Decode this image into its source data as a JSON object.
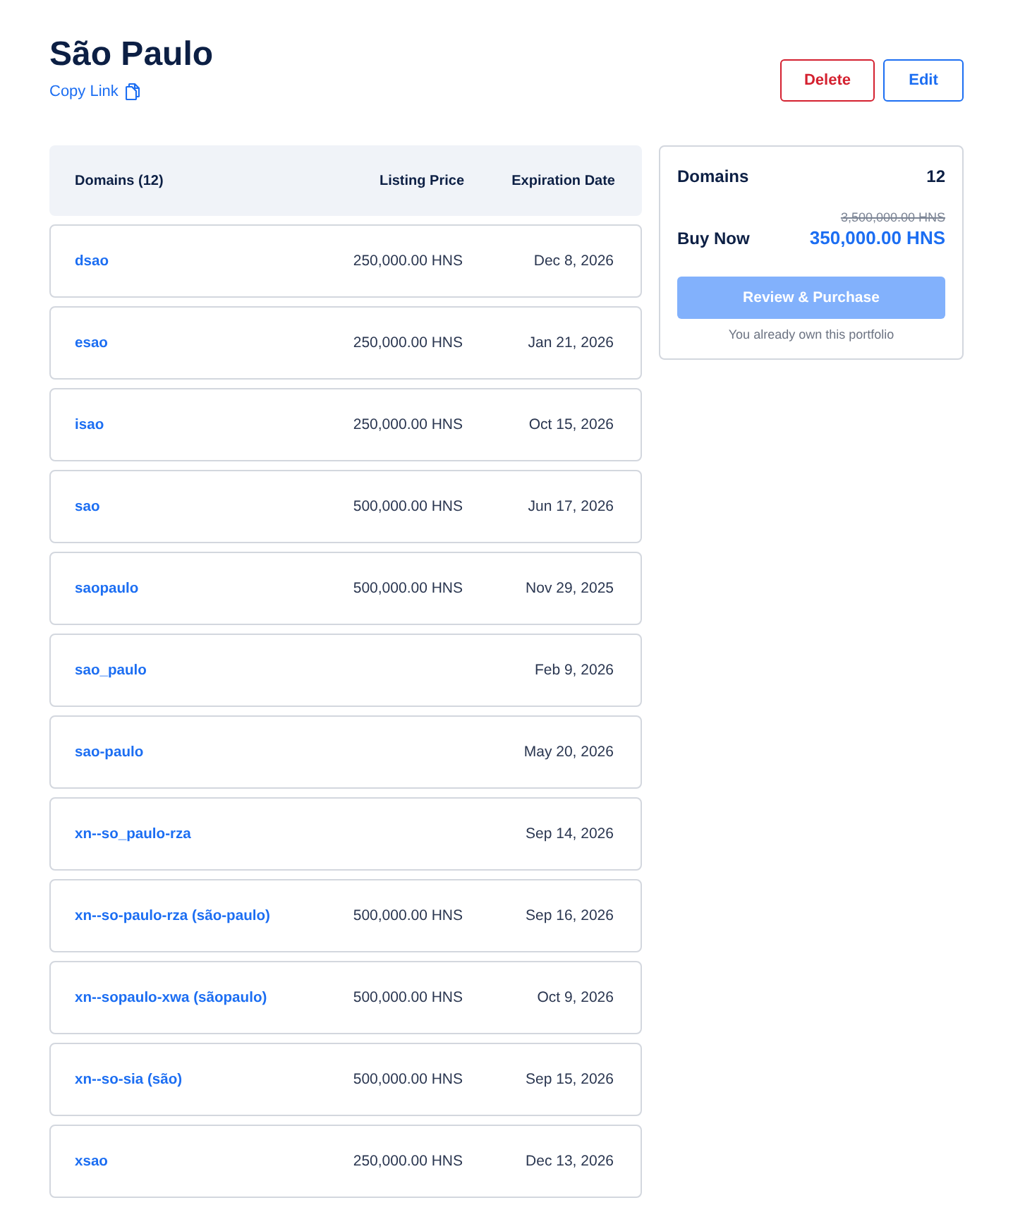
{
  "header": {
    "title": "São Paulo",
    "copy_link": "Copy Link",
    "buttons": [
      {
        "label": "Delete",
        "kind": "danger"
      },
      {
        "label": "Edit",
        "kind": "primary"
      }
    ]
  },
  "table": {
    "columns": [
      "Domains (12)",
      "Listing Price",
      "Expiration Date"
    ],
    "rows": [
      {
        "domain": "dsao",
        "price": "250,000.00 HNS",
        "expiration": "Dec 8, 2026"
      },
      {
        "domain": "esao",
        "price": "250,000.00 HNS",
        "expiration": "Jan 21, 2026"
      },
      {
        "domain": "isao",
        "price": "250,000.00 HNS",
        "expiration": "Oct 15, 2026"
      },
      {
        "domain": "sao",
        "price": "500,000.00 HNS",
        "expiration": "Jun 17, 2026"
      },
      {
        "domain": "saopaulo",
        "price": "500,000.00 HNS",
        "expiration": "Nov 29, 2025"
      },
      {
        "domain": "sao_paulo",
        "expiration": "Feb 9, 2026"
      },
      {
        "domain": "sao-paulo",
        "expiration": "May 20, 2026"
      },
      {
        "domain": "xn--so_paulo-rza",
        "expiration": "Sep 14, 2026"
      },
      {
        "domain": "xn--so-paulo-rza (são-paulo)",
        "price": "500,000.00 HNS",
        "expiration": "Sep 16, 2026"
      },
      {
        "domain": "xn--sopaulo-xwa (sãopaulo)",
        "price": "500,000.00 HNS",
        "expiration": "Oct 9, 2026"
      },
      {
        "domain": "xn--so-sia (são)",
        "price": "500,000.00 HNS",
        "expiration": "Sep 15, 2026"
      },
      {
        "domain": "xsao",
        "price": "250,000.00 HNS",
        "expiration": "Dec 13, 2026"
      }
    ]
  },
  "summary": {
    "label": "Domains",
    "count": "12",
    "original_price": "3,500,000.00 HNS",
    "buy_label": "Buy Now",
    "price": "350,000.00 HNS",
    "button": {
      "label": "Review & Purchase",
      "disabled": true
    },
    "note": "You already own this portfolio"
  }
}
